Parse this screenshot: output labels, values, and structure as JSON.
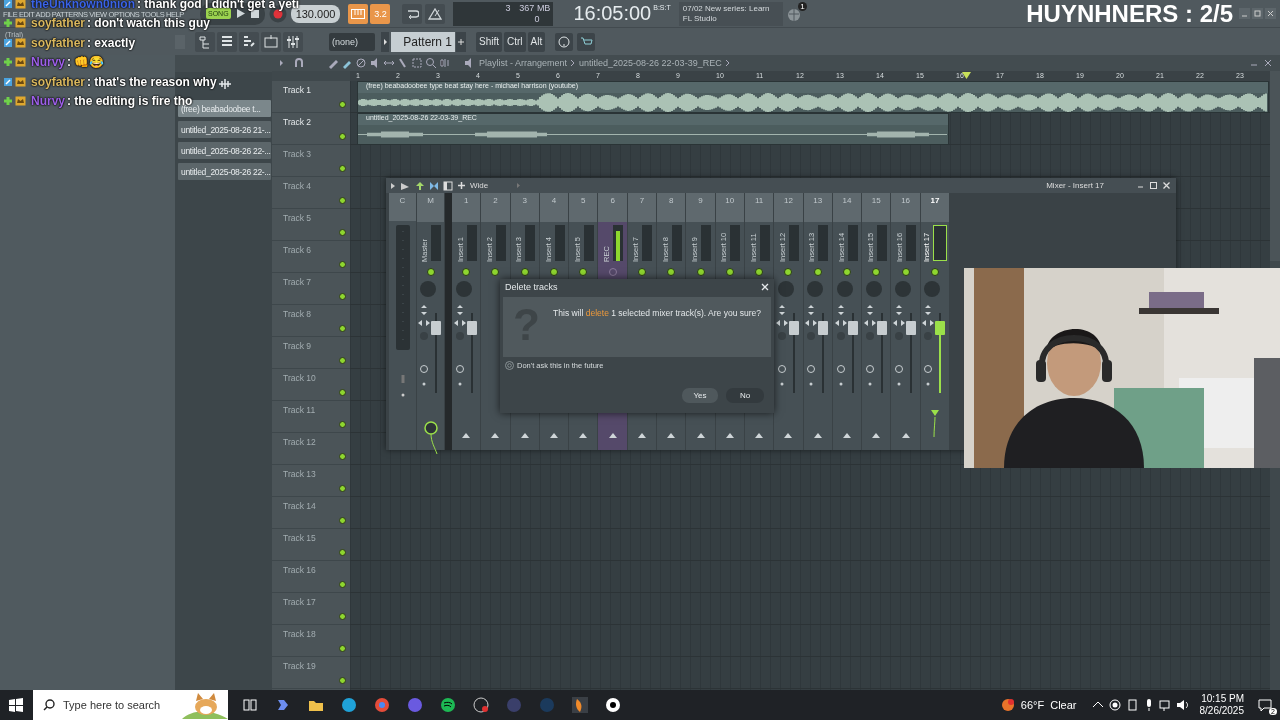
{
  "chat": [
    {
      "user": "theUnknown0nion",
      "color": "#3a63e6",
      "text": ": thank god I didn't get a yeti"
    },
    {
      "user": "soyfather",
      "color": "#d9b75e",
      "text": ": don't watch this guy"
    },
    {
      "user": "soyfather",
      "color": "#d9b75e",
      "text": ": exactly"
    },
    {
      "user": "Nurvy",
      "color": "#9d5fe8",
      "text": ": 👊😂"
    },
    {
      "user": "soyfather",
      "color": "#d9b75e",
      "text": ": that's the reason why"
    },
    {
      "user": "Nurvy",
      "color": "#9d5fe8",
      "text": ": the editing is fire tho"
    }
  ],
  "menu": [
    "FILE",
    "EDIT",
    "ADD",
    "PATTERNS",
    "VIEW",
    "OPTIONS",
    "TOOLS",
    "HELP"
  ],
  "trial_label": "(Trial)",
  "transport": {
    "mode": "SONG",
    "tempo": "130.000",
    "snap": "3.2"
  },
  "monitor": {
    "counter": "3",
    "memory": "367 MB",
    "counter_2": "0"
  },
  "clock": {
    "time": "16:05:00",
    "unit": "B:S:T"
  },
  "hint": {
    "date": "07/02",
    "text": "New series: Learn FL Studio",
    "badge": "1"
  },
  "stream_title": "HUYNHNERS : 2/5",
  "pattern_bar": {
    "selector": "(none)",
    "pattern": "Pattern 1",
    "keys": [
      "Shift",
      "Ctrl",
      "Alt"
    ]
  },
  "browser": {
    "items": [
      {
        "label": "(free) beabadoobee t...",
        "selected": true
      },
      {
        "label": "untitled_2025-08-26 21-...",
        "selected": false
      },
      {
        "label": "untitled_2025-08-26 22-...",
        "selected": false
      },
      {
        "label": "untitled_2025-08-26 22-...",
        "selected": false
      }
    ]
  },
  "playlist": {
    "title": "Playlist - Arrangement",
    "path": "untitled_2025-08-26 22-03-39_REC",
    "bars": [
      "1",
      "2",
      "3",
      "4",
      "5",
      "6",
      "7",
      "8",
      "9",
      "10",
      "11",
      "12",
      "13",
      "14",
      "15",
      "16",
      "17",
      "18",
      "19",
      "20",
      "21",
      "22",
      "23"
    ],
    "tracks": [
      {
        "name": "Track 1",
        "dimmed": false,
        "clip": {
          "title": "(free) beabadoobee type beat stay here - michael harrison (youtube)",
          "kind": "loud"
        }
      },
      {
        "name": "Track 2",
        "dimmed": false,
        "clip": {
          "title": "untitled_2025-08-26 22-03-39_REC",
          "kind": "quiet"
        }
      },
      {
        "name": "Track 3",
        "dimmed": true
      },
      {
        "name": "Track 4",
        "dimmed": true
      },
      {
        "name": "Track 5",
        "dimmed": true
      },
      {
        "name": "Track 6",
        "dimmed": true
      },
      {
        "name": "Track 7",
        "dimmed": true
      },
      {
        "name": "Track 8",
        "dimmed": true
      },
      {
        "name": "Track 9",
        "dimmed": true
      },
      {
        "name": "Track 10",
        "dimmed": true
      },
      {
        "name": "Track 11",
        "dimmed": true
      },
      {
        "name": "Track 12",
        "dimmed": true
      },
      {
        "name": "Track 13",
        "dimmed": true
      },
      {
        "name": "Track 14",
        "dimmed": true
      },
      {
        "name": "Track 15",
        "dimmed": true
      },
      {
        "name": "Track 16",
        "dimmed": true
      },
      {
        "name": "Track 17",
        "dimmed": true
      },
      {
        "name": "Track 18",
        "dimmed": true
      },
      {
        "name": "Track 19",
        "dimmed": true
      }
    ]
  },
  "mixer": {
    "title": "Mixer - Insert 17",
    "view": "Wide",
    "strips": [
      {
        "number": "C",
        "selected": false,
        "armed": false
      },
      {
        "number": "M",
        "name": "Master",
        "selected": false,
        "armed": false
      },
      {
        "number": "1",
        "name": "Insert 1",
        "selected": false,
        "armed": false
      },
      {
        "number": "2",
        "name": "Insert 2",
        "selected": false,
        "armed": false
      },
      {
        "number": "3",
        "name": "Insert 3",
        "selected": false,
        "armed": false
      },
      {
        "number": "4",
        "name": "Insert 4",
        "selected": false,
        "armed": false
      },
      {
        "number": "5",
        "name": "Insert 5",
        "selected": false,
        "armed": false
      },
      {
        "number": "6",
        "name": "REC",
        "selected": false,
        "armed": true
      },
      {
        "number": "7",
        "name": "Insert 7",
        "selected": false,
        "armed": false
      },
      {
        "number": "8",
        "name": "Insert 8",
        "selected": false,
        "armed": false
      },
      {
        "number": "9",
        "name": "Insert 9",
        "selected": false,
        "armed": false
      },
      {
        "number": "10",
        "name": "Insert 10",
        "selected": false,
        "armed": false
      },
      {
        "number": "11",
        "name": "Insert 11",
        "selected": false,
        "armed": false
      },
      {
        "number": "12",
        "name": "Insert 12",
        "selected": false,
        "armed": false
      },
      {
        "number": "13",
        "name": "Insert 13",
        "selected": false,
        "armed": false
      },
      {
        "number": "14",
        "name": "Insert 14",
        "selected": false,
        "armed": false
      },
      {
        "number": "15",
        "name": "Insert 15",
        "selected": false,
        "armed": false
      },
      {
        "number": "16",
        "name": "Insert 16",
        "selected": false,
        "armed": false
      },
      {
        "number": "17",
        "name": "Insert 17",
        "selected": true,
        "armed": false
      }
    ]
  },
  "dialog": {
    "title": "Delete tracks",
    "icon": "?",
    "message_before": "This will ",
    "message_highlight": "delete",
    "message_after": " 1 selected mixer track(s). Are you sure?",
    "checkbox": {
      "label": "Don't ask this in the future",
      "checked": false
    },
    "buttons": [
      "Yes",
      "No"
    ]
  },
  "taskbar": {
    "search_placeholder": "Type here to search",
    "temperature": "66°F",
    "condition": "Clear",
    "time": "10:15 PM",
    "date": "8/26/2025",
    "notifications": "2"
  }
}
